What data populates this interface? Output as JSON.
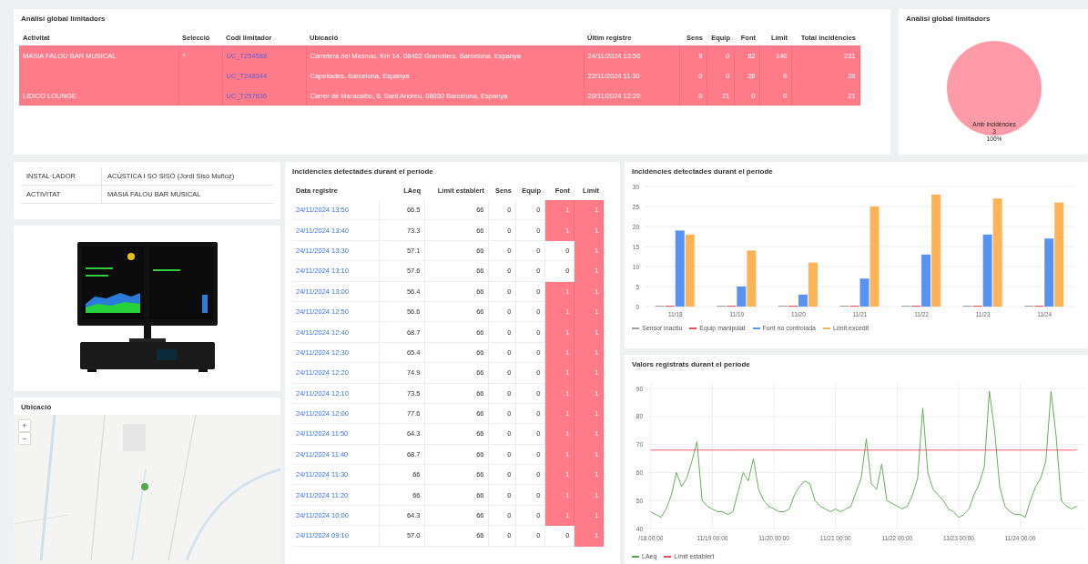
{
  "limiters": {
    "title": "Anàlisi global limitadors",
    "columns": [
      "Activitat",
      "Selecció",
      "Codi limitador",
      "Ubicació",
      "Últim registre",
      "Sens",
      "Equip",
      "Font",
      "Límit",
      "Total incidències"
    ],
    "rows": [
      {
        "activity": "MASIA FALOU BAR MUSICAL",
        "selection": "*",
        "code": "UC_T254588",
        "location": "Carretera del Masnou, Km 14, 08402 Granollers, Barcelona, Espanya",
        "last_record": "24/11/2024 13:50",
        "sens": "9",
        "equip": "0",
        "font": "82",
        "limit": "140",
        "total": "231",
        "alert": true
      },
      {
        "activity": "",
        "selection": "",
        "code": "UC_T248344",
        "location": "Capellades, Barcelona, Espanya",
        "last_record": "22/11/2024 11:30",
        "sens": "0",
        "equip": "0",
        "font": "28",
        "limit": "0",
        "total": "28",
        "alert": true
      },
      {
        "activity": "LIDICO LOUNGE",
        "selection": "",
        "code": "UC_T257636",
        "location": "Carrer de Maracaibo, 6, Sant Andreu, 08030 Barcelona, Espanya",
        "last_record": "20/11/2024 12:20",
        "sens": "0",
        "equip": "21",
        "font": "0",
        "limit": "0",
        "total": "21",
        "alert": true
      }
    ]
  },
  "summary": {
    "title": "Anàlisi global limitadors",
    "slice_percent": "100%",
    "chart_data": {
      "type": "pie",
      "categories": [
        "Amb incidències"
      ],
      "values": [
        3
      ],
      "data_labels": true
    }
  },
  "info": [
    {
      "label": "INSTAL·LADOR",
      "value": "ACÚSTICA I SO SISÓ (Jordi Sisó Muñoz)"
    },
    {
      "label": "ACTIVITAT",
      "value": "MASIA FALOU BAR MUSICAL"
    }
  ],
  "map": {
    "title": "Ubicació",
    "zoom_in": "+",
    "zoom_out": "−"
  },
  "incidents": {
    "title": "Incidències detectades durant el període",
    "columns": [
      "Data registre",
      "LAeq",
      "Límit establert",
      "Sens",
      "Equip",
      "Font",
      "Límit"
    ],
    "rows": [
      {
        "date": "24/11/2024 13:50",
        "laeq": "66.5",
        "limit_set": "66",
        "sens": "0",
        "equip": "0",
        "font": "1",
        "font_alert": true,
        "limit": "1",
        "limit_alert": true
      },
      {
        "date": "24/11/2024 13:40",
        "laeq": "73.3",
        "limit_set": "66",
        "sens": "0",
        "equip": "0",
        "font": "1",
        "font_alert": true,
        "limit": "1",
        "limit_alert": true
      },
      {
        "date": "24/11/2024 13:30",
        "laeq": "57.1",
        "limit_set": "66",
        "sens": "0",
        "equip": "0",
        "font": "0",
        "font_alert": false,
        "limit": "1",
        "limit_alert": true
      },
      {
        "date": "24/11/2024 13:10",
        "laeq": "57.6",
        "limit_set": "66",
        "sens": "0",
        "equip": "0",
        "font": "0",
        "font_alert": false,
        "limit": "1",
        "limit_alert": true
      },
      {
        "date": "24/11/2024 13:00",
        "laeq": "56.4",
        "limit_set": "66",
        "sens": "0",
        "equip": "0",
        "font": "1",
        "font_alert": true,
        "limit": "1",
        "limit_alert": true
      },
      {
        "date": "24/11/2024 12:50",
        "laeq": "56.6",
        "limit_set": "66",
        "sens": "0",
        "equip": "0",
        "font": "1",
        "font_alert": true,
        "limit": "1",
        "limit_alert": true
      },
      {
        "date": "24/11/2024 12:40",
        "laeq": "68.7",
        "limit_set": "66",
        "sens": "0",
        "equip": "0",
        "font": "1",
        "font_alert": true,
        "limit": "1",
        "limit_alert": true
      },
      {
        "date": "24/11/2024 12:30",
        "laeq": "65.4",
        "limit_set": "66",
        "sens": "0",
        "equip": "0",
        "font": "1",
        "font_alert": true,
        "limit": "1",
        "limit_alert": true
      },
      {
        "date": "24/11/2024 12:20",
        "laeq": "74.9",
        "limit_set": "66",
        "sens": "0",
        "equip": "0",
        "font": "1",
        "font_alert": true,
        "limit": "1",
        "limit_alert": true
      },
      {
        "date": "24/11/2024 12:10",
        "laeq": "73.5",
        "limit_set": "66",
        "sens": "0",
        "equip": "0",
        "font": "1",
        "font_alert": true,
        "limit": "1",
        "limit_alert": true
      },
      {
        "date": "24/11/2024 12:00",
        "laeq": "77.6",
        "limit_set": "66",
        "sens": "0",
        "equip": "0",
        "font": "1",
        "font_alert": true,
        "limit": "1",
        "limit_alert": true
      },
      {
        "date": "24/11/2024 11:50",
        "laeq": "64.3",
        "limit_set": "66",
        "sens": "0",
        "equip": "0",
        "font": "1",
        "font_alert": true,
        "limit": "1",
        "limit_alert": true
      },
      {
        "date": "24/11/2024 11:40",
        "laeq": "68.7",
        "limit_set": "66",
        "sens": "0",
        "equip": "0",
        "font": "1",
        "font_alert": true,
        "limit": "1",
        "limit_alert": true
      },
      {
        "date": "24/11/2024 11:30",
        "laeq": "66",
        "limit_set": "66",
        "sens": "0",
        "equip": "0",
        "font": "1",
        "font_alert": true,
        "limit": "1",
        "limit_alert": true
      },
      {
        "date": "24/11/2024 11:20",
        "laeq": "66",
        "limit_set": "66",
        "sens": "0",
        "equip": "0",
        "font": "1",
        "font_alert": true,
        "limit": "1",
        "limit_alert": true
      },
      {
        "date": "24/11/2024 10:00",
        "laeq": "64.3",
        "limit_set": "66",
        "sens": "0",
        "equip": "0",
        "font": "1",
        "font_alert": true,
        "limit": "1",
        "limit_alert": true
      },
      {
        "date": "24/11/2024 09:10",
        "laeq": "57.0",
        "limit_set": "66",
        "sens": "0",
        "equip": "0",
        "font": "0",
        "font_alert": false,
        "limit": "1",
        "limit_alert": true
      }
    ]
  },
  "incident_chart": {
    "title": "Incidències detectades durant el període",
    "chart_data": {
      "type": "bar",
      "grid": true,
      "categories": [
        "11/18",
        "11/19",
        "11/20",
        "11/21",
        "11/22",
        "11/23",
        "11/24"
      ],
      "ylim": [
        0,
        30
      ],
      "yticks": [
        0,
        5,
        10,
        15,
        20,
        25,
        30
      ],
      "series": [
        {
          "name": "Sensor inactiu",
          "color": "#9e9e9e",
          "values": [
            0,
            0,
            0,
            0,
            0,
            0,
            0
          ]
        },
        {
          "name": "Equip manipulat",
          "color": "#f2495c",
          "values": [
            0,
            0,
            0,
            0,
            0,
            0,
            0
          ]
        },
        {
          "name": "Font no controlada",
          "color": "#5794f2",
          "values": [
            19,
            5,
            3,
            7,
            13,
            18,
            17
          ]
        },
        {
          "name": "Límit excedit",
          "color": "#ffb357",
          "values": [
            18,
            14,
            11,
            25,
            28,
            27,
            26
          ]
        }
      ]
    }
  },
  "values_chart": {
    "title": "Valors registrats durant el període",
    "chart_data": {
      "type": "line",
      "grid": true,
      "ylim": [
        40,
        92
      ],
      "yticks": [
        40,
        50,
        60,
        70,
        80,
        90
      ],
      "categories": [
        "/18 00:00",
        null,
        null,
        null,
        null,
        null,
        null,
        null,
        null,
        null,
        null,
        null,
        "11/19 00:00",
        null,
        null,
        null,
        null,
        null,
        null,
        null,
        null,
        null,
        null,
        null,
        "11/20 00:00",
        null,
        null,
        null,
        null,
        null,
        null,
        null,
        null,
        null,
        null,
        null,
        "11/21 00:00",
        null,
        null,
        null,
        null,
        null,
        null,
        null,
        null,
        null,
        null,
        null,
        "11/22 00:00",
        null,
        null,
        null,
        null,
        null,
        null,
        null,
        null,
        null,
        null,
        null,
        "11/23 00:00",
        null,
        null,
        null,
        null,
        null,
        null,
        null,
        null,
        null,
        null,
        null,
        "11/24 00:00",
        null,
        null,
        null,
        null,
        null,
        null,
        null,
        null,
        null,
        null,
        null
      ],
      "series": [
        {
          "name": "LAeq",
          "color": "#56a64b",
          "values": [
            46,
            45,
            44,
            47,
            52,
            60,
            55,
            58,
            64,
            71,
            50,
            48,
            47,
            46,
            46,
            45,
            46,
            53,
            60,
            57,
            65,
            54,
            50,
            48,
            47,
            46,
            46,
            47,
            52,
            55,
            57,
            56,
            50,
            48,
            47,
            46,
            47,
            46,
            47,
            48,
            53,
            58,
            72,
            56,
            54,
            63,
            50,
            49,
            48,
            47,
            48,
            52,
            58,
            83,
            60,
            54,
            52,
            50,
            47,
            46,
            44,
            45,
            47,
            52,
            56,
            62,
            89,
            75,
            55,
            48,
            46,
            45,
            45,
            44,
            50,
            55,
            58,
            64,
            89,
            73,
            50,
            48,
            47,
            48
          ]
        },
        {
          "name": "Límit establert",
          "color": "#f2495c",
          "values": [
            68,
            68,
            68,
            68,
            68,
            68,
            68,
            68,
            68,
            68,
            68,
            68,
            68,
            68,
            68,
            68,
            68,
            68,
            68,
            68,
            68,
            68,
            68,
            68,
            68,
            68,
            68,
            68,
            68,
            68,
            68,
            68,
            68,
            68,
            68,
            68,
            68,
            68,
            68,
            68,
            68,
            68,
            68,
            68,
            68,
            68,
            68,
            68,
            68,
            68,
            68,
            68,
            68,
            68,
            68,
            68,
            68,
            68,
            68,
            68,
            68,
            68,
            68,
            68,
            68,
            68,
            68,
            68,
            68,
            68,
            68,
            68,
            68,
            68,
            68,
            68,
            68,
            68,
            68,
            68,
            68,
            68,
            68,
            68
          ]
        }
      ]
    }
  }
}
